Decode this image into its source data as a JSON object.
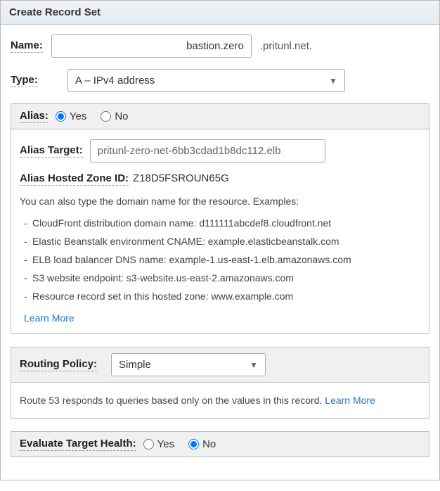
{
  "header": {
    "title": "Create Record Set"
  },
  "name": {
    "label": "Name:",
    "value": "bastion.zero",
    "suffix": ".pritunl.net."
  },
  "type": {
    "label": "Type:",
    "selected": "A – IPv4 address"
  },
  "alias": {
    "label": "Alias:",
    "yes": "Yes",
    "no": "No",
    "target_label": "Alias Target:",
    "target_value": "pritunl-zero-net-6bb3cdad1b8dc112.elb",
    "hosted_zone_label": "Alias Hosted Zone ID:",
    "hosted_zone_value": "Z18D5FSROUN65G",
    "help_intro": "You can also type the domain name for the resource. Examples:",
    "examples": [
      "CloudFront distribution domain name: d111111abcdef8.cloudfront.net",
      "Elastic Beanstalk environment CNAME: example.elasticbeanstalk.com",
      "ELB load balancer DNS name: example-1.us-east-1.elb.amazonaws.com",
      "S3 website endpoint: s3-website.us-east-2.amazonaws.com",
      "Resource record set in this hosted zone: www.example.com"
    ],
    "learn_more": "Learn More"
  },
  "routing": {
    "label": "Routing Policy:",
    "selected": "Simple",
    "desc_prefix": "Route 53 responds to queries based only on the values in this record.  ",
    "learn_more": "Learn More"
  },
  "eval_health": {
    "label": "Evaluate Target Health:",
    "yes": "Yes",
    "no": "No"
  }
}
